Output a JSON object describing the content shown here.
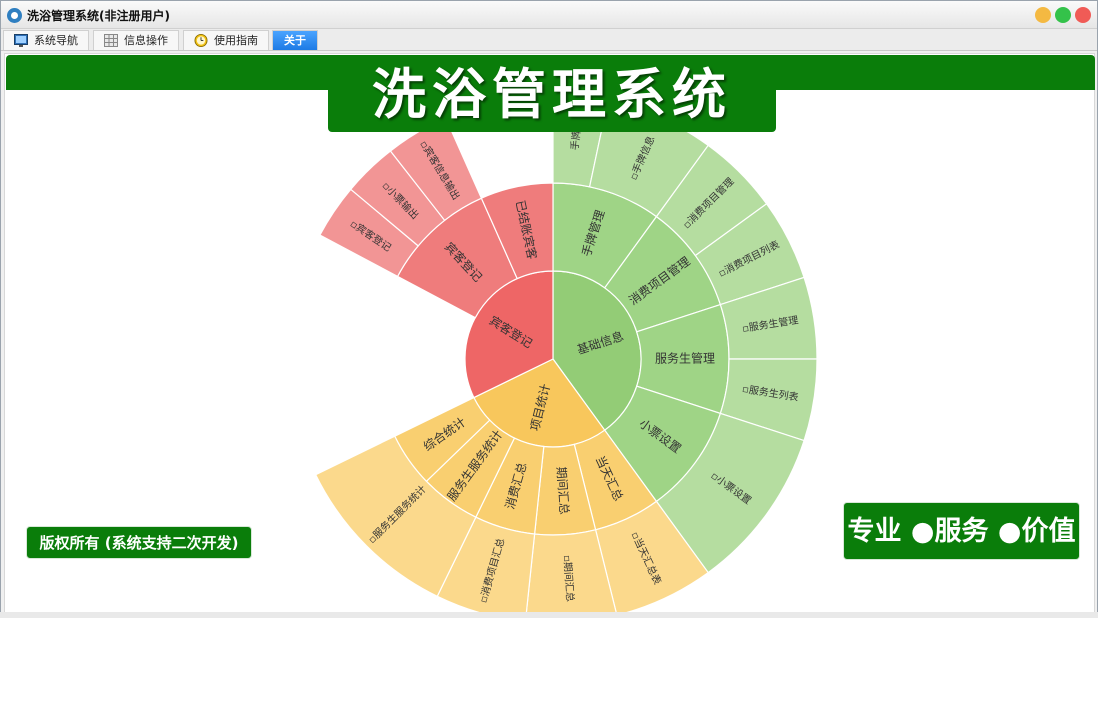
{
  "window": {
    "title": "洗浴管理系统(非注册用户)",
    "controls": {
      "minimize_color": "#f4b942",
      "maximize_color": "#34c24a",
      "close_color": "#f05b56"
    }
  },
  "tabs": [
    {
      "label": "系统导航",
      "icon": "monitor-icon"
    },
    {
      "label": "信息操作",
      "icon": "grid-icon"
    },
    {
      "label": "使用指南",
      "icon": "clock-icon"
    },
    {
      "label": "关于",
      "icon": "",
      "active": true
    }
  ],
  "main": {
    "title": "洗浴管理系统",
    "copyright": "版权所有 (系统支持二次开发)",
    "slogan": "专业 ●服务 ●价值",
    "brand_color": "#0a7d0a"
  },
  "sunburst": {
    "groups": [
      {
        "label": "基础信息",
        "color": "#93cc76",
        "mid_color": "#9fd486",
        "outer_color": "#b5dda0",
        "children": [
          {
            "label": "手牌管理",
            "leaves": [
              "手牌",
              "▫手牌信息"
            ]
          },
          {
            "label": "消费项目管理",
            "leaves": [
              "▫消费项目管理",
              "▫消费项目列表"
            ]
          },
          {
            "label": "服务生管理",
            "leaves": [
              "▫服务生管理",
              "▫服务生列表"
            ]
          },
          {
            "label": "小票设置",
            "leaves": [
              "▫小票设置"
            ]
          }
        ]
      },
      {
        "label": "项目统计",
        "color": "#f8c75c",
        "mid_color": "#f9cf70",
        "outer_color": "#fbd98c",
        "children": [
          {
            "label": "当天汇总",
            "leaves": [
              "▫当天汇总表"
            ]
          },
          {
            "label": "期间汇总",
            "leaves": [
              "▫期间汇总"
            ]
          },
          {
            "label": "消费汇总",
            "leaves": [
              "▫消费项目汇总"
            ]
          },
          {
            "label": "服务生服务统计",
            "leaves": [
              "▫服务生服务统计"
            ]
          },
          {
            "label": "综合统计",
            "leaves": []
          }
        ]
      },
      {
        "label": "宾客登记",
        "color": "#ee6666",
        "mid_color": "#ef7c7c",
        "outer_color": "#f29595",
        "children": [
          {
            "label": "宾客登记",
            "leaves": [
              "▫宾客登记",
              "▫小票输出",
              "▫宾客信息输出"
            ]
          },
          {
            "label": "已结账宾客",
            "leaves": []
          }
        ]
      }
    ]
  }
}
